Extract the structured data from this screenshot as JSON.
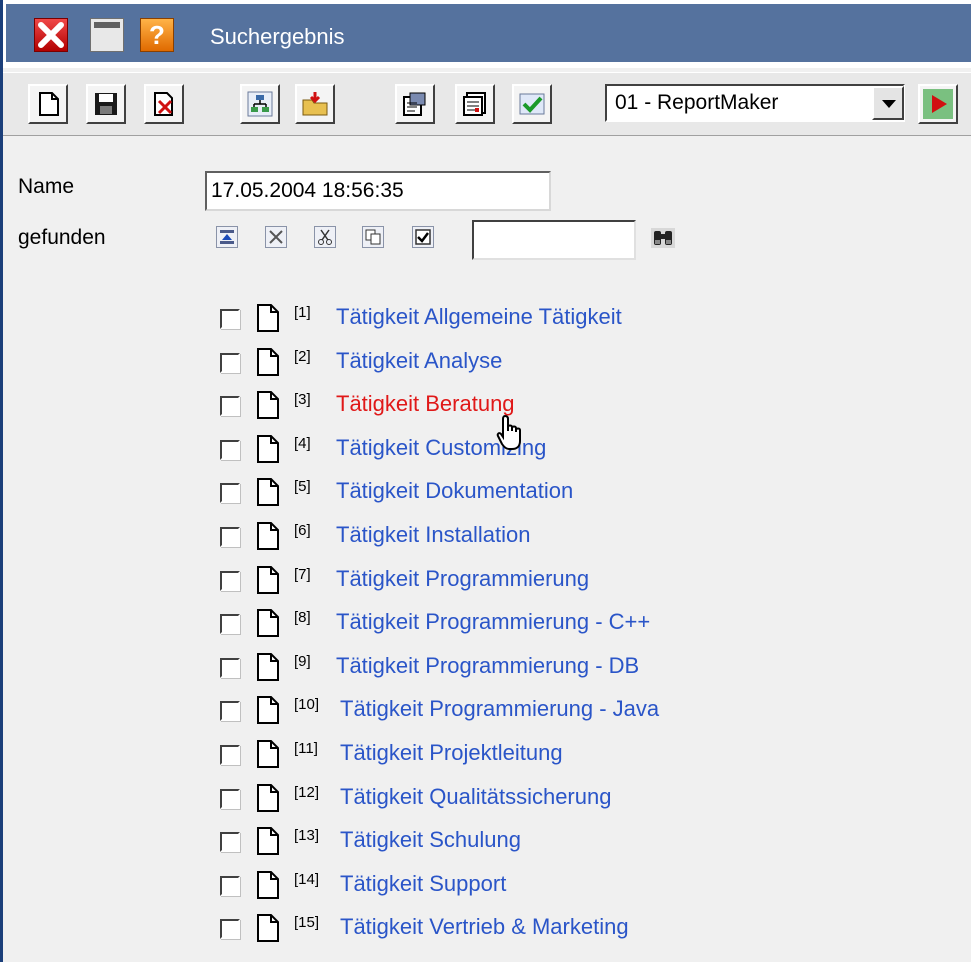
{
  "window": {
    "title": "Suchergebnis",
    "icons": [
      "close-icon",
      "minimize-icon",
      "help-icon"
    ],
    "help_glyph": "?"
  },
  "toolbar": {
    "buttons": [
      "new-document-icon",
      "save-icon",
      "delete-icon",
      "tree-icon",
      "open-folder-icon",
      "properties-icon",
      "report-icon",
      "check-icon"
    ],
    "combo_value": "01 - ReportMaker",
    "run_icon": "play-icon"
  },
  "form": {
    "name_label": "Name",
    "name_value": "17.05.2004 18:56:35",
    "found_label": "gefunden",
    "selection_icons": [
      "move-up-icon",
      "cross-icon",
      "cut-icon",
      "copy-icon",
      "checkbox-icon"
    ],
    "filter_value": "",
    "find_icon": "binoculars-icon"
  },
  "results": [
    {
      "index": "[1]",
      "label": "Tätigkeit Allgemeine Tätigkeit",
      "checked": false
    },
    {
      "index": "[2]",
      "label": "Tätigkeit Analyse",
      "checked": false
    },
    {
      "index": "[3]",
      "label": "Tätigkeit Beratung",
      "checked": false,
      "hovered": true
    },
    {
      "index": "[4]",
      "label": "Tätigkeit Customizing",
      "checked": false
    },
    {
      "index": "[5]",
      "label": "Tätigkeit Dokumentation",
      "checked": false
    },
    {
      "index": "[6]",
      "label": "Tätigkeit Installation",
      "checked": false
    },
    {
      "index": "[7]",
      "label": "Tätigkeit Programmierung",
      "checked": false
    },
    {
      "index": "[8]",
      "label": "Tätigkeit Programmierung - C++",
      "checked": false
    },
    {
      "index": "[9]",
      "label": "Tätigkeit Programmierung - DB",
      "checked": false
    },
    {
      "index": "[10]",
      "label": "Tätigkeit Programmierung - Java",
      "checked": false
    },
    {
      "index": "[11]",
      "label": "Tätigkeit Projektleitung",
      "checked": false
    },
    {
      "index": "[12]",
      "label": "Tätigkeit Qualitätssicherung",
      "checked": false
    },
    {
      "index": "[13]",
      "label": "Tätigkeit Schulung",
      "checked": false
    },
    {
      "index": "[14]",
      "label": "Tätigkeit Support",
      "checked": false
    },
    {
      "index": "[15]",
      "label": "Tätigkeit Vertrieb & Marketing",
      "checked": false
    }
  ],
  "colors": {
    "title_bar": "#55729e",
    "link": "#2a55c8",
    "link_hover": "#e01818"
  }
}
